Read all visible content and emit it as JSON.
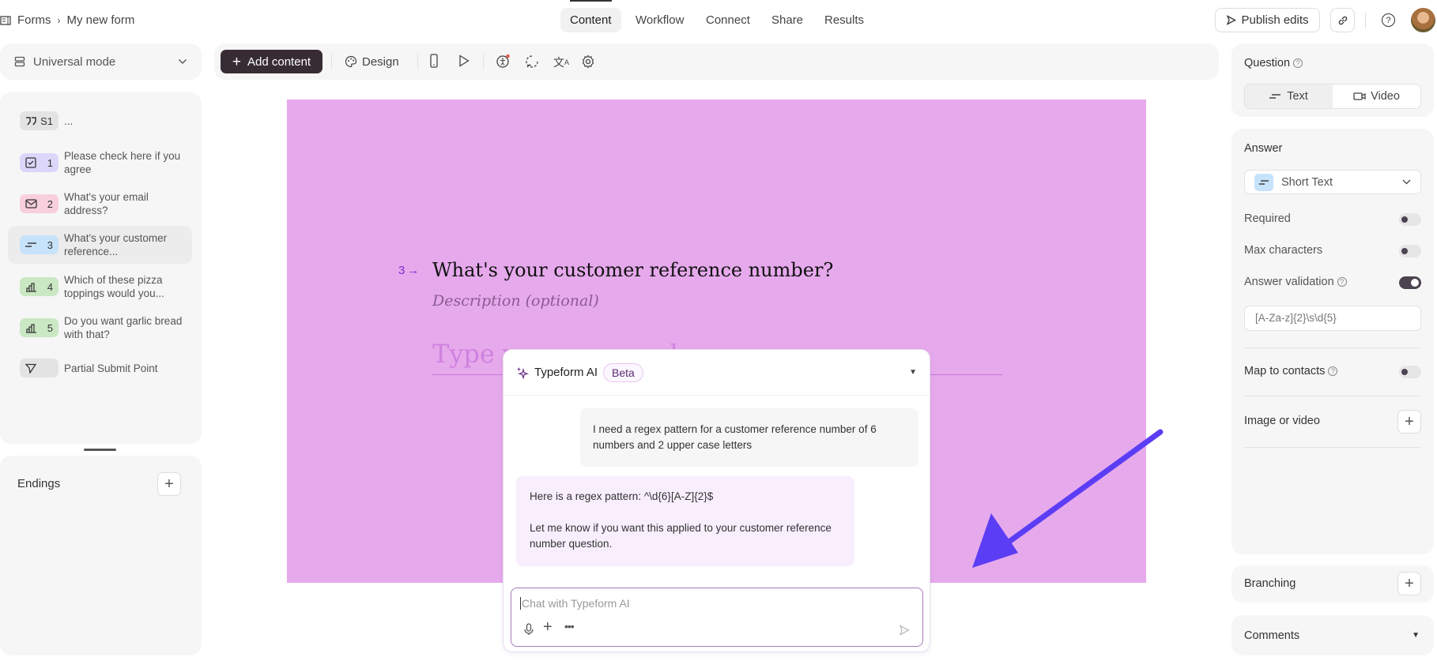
{
  "header": {
    "breadcrumb": [
      "Forms",
      "My new form"
    ],
    "tabs": [
      {
        "label": "Content",
        "active": true
      },
      {
        "label": "Workflow"
      },
      {
        "label": "Connect"
      },
      {
        "label": "Share"
      },
      {
        "label": "Results"
      }
    ],
    "publish_label": "Publish edits"
  },
  "left": {
    "mode_label": "Universal mode",
    "items": [
      {
        "num": "S1",
        "text": "...",
        "color": "#e3e3e3",
        "icon": "quote-icon"
      },
      {
        "num": "1",
        "text": "Please check here if you agree",
        "color": "#ddd6fb",
        "icon": "checkbox-icon"
      },
      {
        "num": "2",
        "text": "What's your email address?",
        "color": "#f8cfdc",
        "icon": "mail-icon"
      },
      {
        "num": "3",
        "text": "What's your customer reference...",
        "color": "#c7e2fb",
        "icon": "short-text-icon",
        "selected": true
      },
      {
        "num": "4",
        "text": "Which of these pizza toppings would you...",
        "color": "#c9e8c3",
        "icon": "rating-icon"
      },
      {
        "num": "5",
        "text": "Do you want garlic bread with that?",
        "color": "#c9e8c3",
        "icon": "rating-icon"
      },
      {
        "num": "",
        "text": "Partial Submit Point",
        "color": "#e3e3e3",
        "icon": "send-icon"
      }
    ],
    "endings_label": "Endings"
  },
  "toolbar": {
    "add_content": "Add content",
    "design": "Design"
  },
  "canvas": {
    "bg_color": "#e6a9ec",
    "question_number": "3",
    "question_title": "What's your customer reference number?",
    "description_placeholder": "Description (optional)",
    "answer_placeholder": "Type your answer here..."
  },
  "ai_chat": {
    "title": "Typeform AI",
    "badge": "Beta",
    "messages": [
      {
        "role": "user",
        "text": "I need a regex pattern for a customer reference number of 6 numbers and 2 upper case letters"
      },
      {
        "role": "ai",
        "line1": "Here is a regex pattern: ^\\d{6}[A-Z]{2}$",
        "line2": "Let me know if you want this applied to your customer reference number question."
      }
    ],
    "input_placeholder": "Chat with Typeform AI"
  },
  "right": {
    "question_label": "Question",
    "seg_text": "Text",
    "seg_video": "Video",
    "answer_label": "Answer",
    "answer_type": "Short Text",
    "required_label": "Required",
    "required_on": false,
    "max_chars_label": "Max characters",
    "max_chars_on": false,
    "validation_label": "Answer validation",
    "validation_on": true,
    "validation_value": "[A-Za-z]{2}\\s\\d{5}",
    "map_contacts_label": "Map to contacts",
    "map_contacts_on": false,
    "image_video_label": "Image or video",
    "branching_label": "Branching",
    "comments_label": "Comments"
  },
  "annotation": {
    "arrow_color": "#5b3df5"
  }
}
